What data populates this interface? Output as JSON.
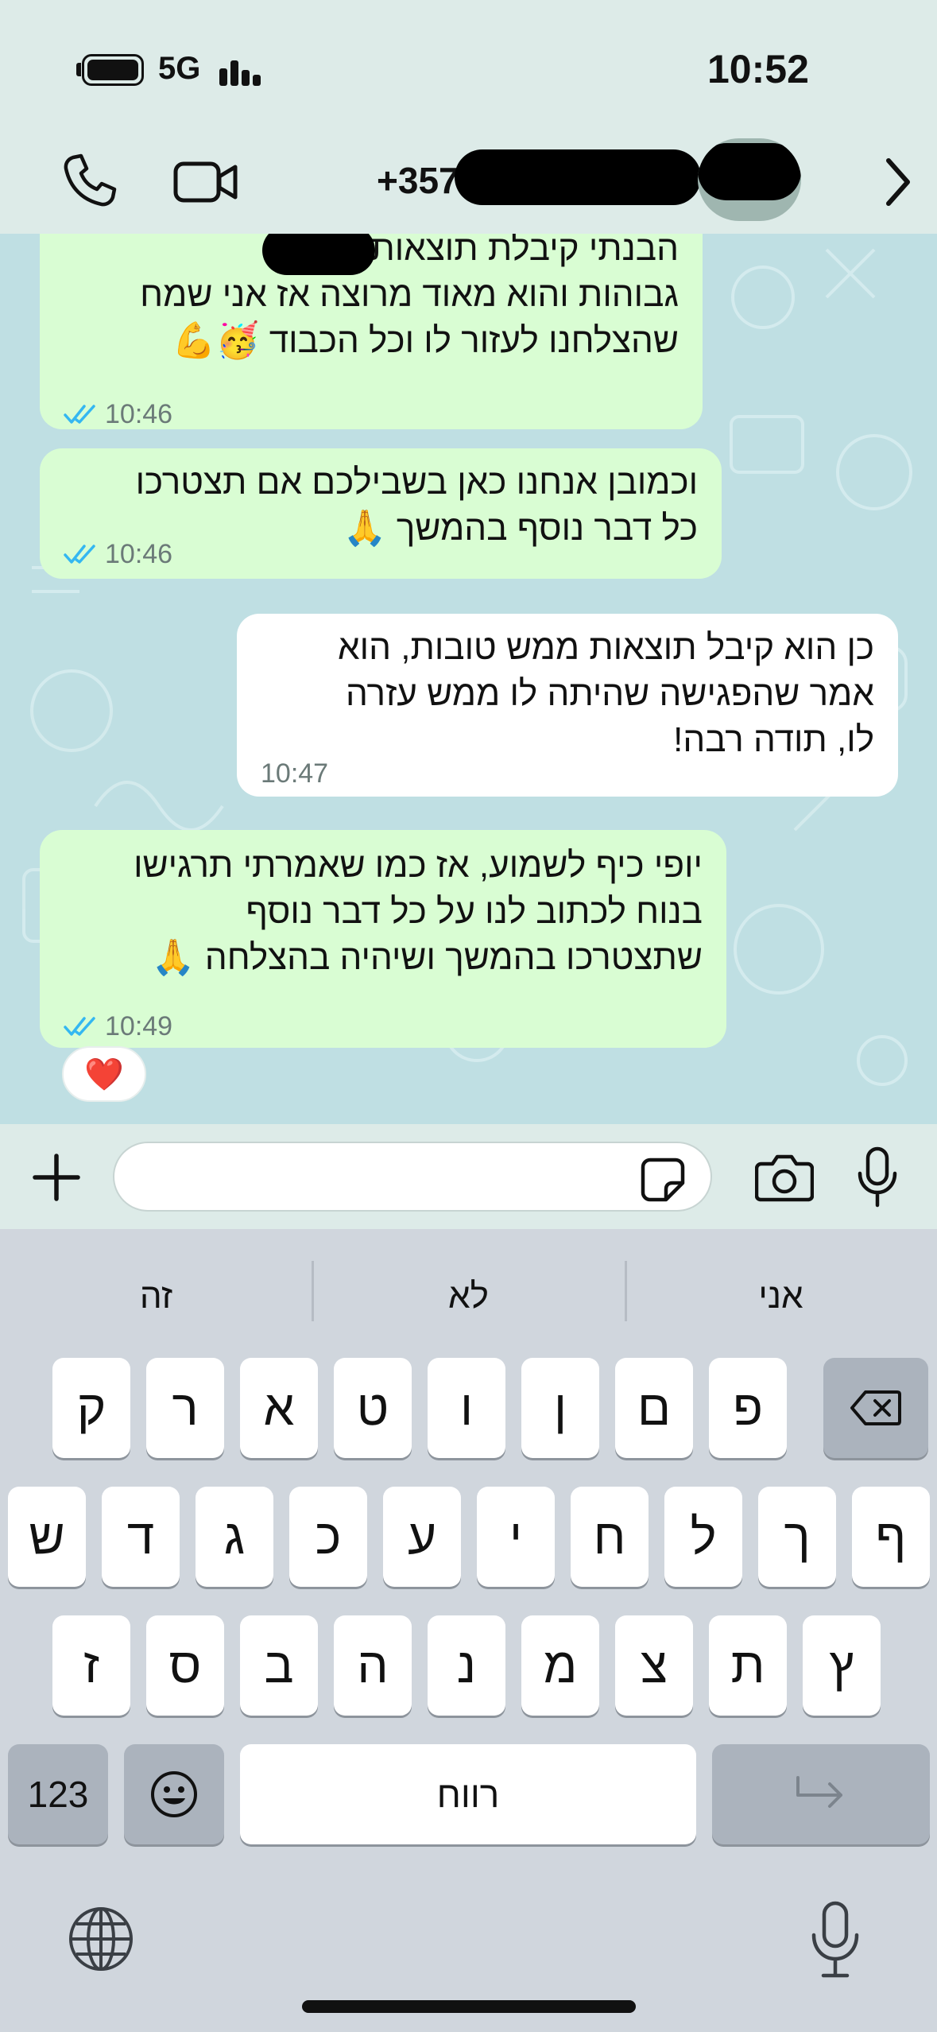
{
  "status_bar": {
    "network": "5G",
    "time": "10:52"
  },
  "chat_header": {
    "contact_number_visible": "+357",
    "icons": [
      "phone-icon",
      "video-camera-icon",
      "chevron-right-icon"
    ]
  },
  "messages": [
    {
      "direction": "outgoing",
      "lines": [
        "הבנתי        קיבלת תוצאות ממש",
        "גבוהות והוא מאוד מרוצה אז אני שמח",
        "שהצלחנו לעזור לו וכל הכבוד 🥳💪"
      ],
      "time": "10:46",
      "status": "read"
    },
    {
      "direction": "outgoing",
      "lines": [
        "וכמובן אנחנו כאן בשבילכם אם תצטרכו",
        "כל דבר נוסף בהמשך 🙏"
      ],
      "time": "10:46",
      "status": "read"
    },
    {
      "direction": "incoming",
      "lines": [
        "כן הוא קיבל תוצאות ממש טובות, הוא",
        "אמר שהפגישה שהיתה לו ממש עזרה",
        "לו, תודה רבה!"
      ],
      "time": "10:47"
    },
    {
      "direction": "outgoing",
      "lines": [
        "יופי כיף לשמוע, אז כמו שאמרתי תרגישו",
        "בנוח לכתוב לנו על כל דבר נוסף",
        "שתצטרכו בהמשך ושיהיה בהצלחה 🙏"
      ],
      "time": "10:49",
      "status": "read",
      "reaction": "❤️"
    }
  ],
  "compose": {
    "placeholder": "",
    "value": ""
  },
  "keyboard": {
    "suggestions": [
      "זה",
      "לא",
      "אני"
    ],
    "row1": [
      "ק",
      "ר",
      "א",
      "ט",
      "ו",
      "ן",
      "ם",
      "פ"
    ],
    "row2": [
      "ש",
      "ד",
      "ג",
      "כ",
      "ע",
      "י",
      "ח",
      "ל",
      "ך",
      "ף"
    ],
    "row3": [
      "ז",
      "ס",
      "ב",
      "ה",
      "נ",
      "מ",
      "צ",
      "ת",
      "ץ"
    ],
    "numbers_key": "123",
    "space_key": "רווח"
  },
  "colors": {
    "outgoing_bubble": "#d9fdd3",
    "incoming_bubble": "#ffffff",
    "read_ticks": "#34b7f1",
    "heart": "#e8453c"
  }
}
